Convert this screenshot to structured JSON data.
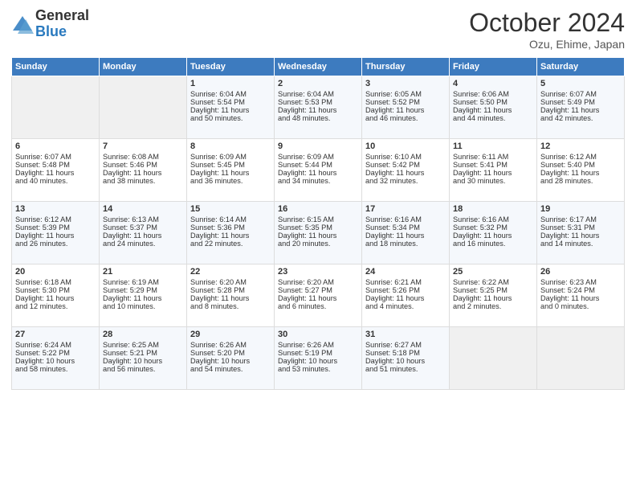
{
  "logo": {
    "general": "General",
    "blue": "Blue"
  },
  "title": "October 2024",
  "subtitle": "Ozu, Ehime, Japan",
  "headers": [
    "Sunday",
    "Monday",
    "Tuesday",
    "Wednesday",
    "Thursday",
    "Friday",
    "Saturday"
  ],
  "weeks": [
    [
      {
        "day": "",
        "lines": []
      },
      {
        "day": "",
        "lines": []
      },
      {
        "day": "1",
        "lines": [
          "Sunrise: 6:04 AM",
          "Sunset: 5:54 PM",
          "Daylight: 11 hours",
          "and 50 minutes."
        ]
      },
      {
        "day": "2",
        "lines": [
          "Sunrise: 6:04 AM",
          "Sunset: 5:53 PM",
          "Daylight: 11 hours",
          "and 48 minutes."
        ]
      },
      {
        "day": "3",
        "lines": [
          "Sunrise: 6:05 AM",
          "Sunset: 5:52 PM",
          "Daylight: 11 hours",
          "and 46 minutes."
        ]
      },
      {
        "day": "4",
        "lines": [
          "Sunrise: 6:06 AM",
          "Sunset: 5:50 PM",
          "Daylight: 11 hours",
          "and 44 minutes."
        ]
      },
      {
        "day": "5",
        "lines": [
          "Sunrise: 6:07 AM",
          "Sunset: 5:49 PM",
          "Daylight: 11 hours",
          "and 42 minutes."
        ]
      }
    ],
    [
      {
        "day": "6",
        "lines": [
          "Sunrise: 6:07 AM",
          "Sunset: 5:48 PM",
          "Daylight: 11 hours",
          "and 40 minutes."
        ]
      },
      {
        "day": "7",
        "lines": [
          "Sunrise: 6:08 AM",
          "Sunset: 5:46 PM",
          "Daylight: 11 hours",
          "and 38 minutes."
        ]
      },
      {
        "day": "8",
        "lines": [
          "Sunrise: 6:09 AM",
          "Sunset: 5:45 PM",
          "Daylight: 11 hours",
          "and 36 minutes."
        ]
      },
      {
        "day": "9",
        "lines": [
          "Sunrise: 6:09 AM",
          "Sunset: 5:44 PM",
          "Daylight: 11 hours",
          "and 34 minutes."
        ]
      },
      {
        "day": "10",
        "lines": [
          "Sunrise: 6:10 AM",
          "Sunset: 5:42 PM",
          "Daylight: 11 hours",
          "and 32 minutes."
        ]
      },
      {
        "day": "11",
        "lines": [
          "Sunrise: 6:11 AM",
          "Sunset: 5:41 PM",
          "Daylight: 11 hours",
          "and 30 minutes."
        ]
      },
      {
        "day": "12",
        "lines": [
          "Sunrise: 6:12 AM",
          "Sunset: 5:40 PM",
          "Daylight: 11 hours",
          "and 28 minutes."
        ]
      }
    ],
    [
      {
        "day": "13",
        "lines": [
          "Sunrise: 6:12 AM",
          "Sunset: 5:39 PM",
          "Daylight: 11 hours",
          "and 26 minutes."
        ]
      },
      {
        "day": "14",
        "lines": [
          "Sunrise: 6:13 AM",
          "Sunset: 5:37 PM",
          "Daylight: 11 hours",
          "and 24 minutes."
        ]
      },
      {
        "day": "15",
        "lines": [
          "Sunrise: 6:14 AM",
          "Sunset: 5:36 PM",
          "Daylight: 11 hours",
          "and 22 minutes."
        ]
      },
      {
        "day": "16",
        "lines": [
          "Sunrise: 6:15 AM",
          "Sunset: 5:35 PM",
          "Daylight: 11 hours",
          "and 20 minutes."
        ]
      },
      {
        "day": "17",
        "lines": [
          "Sunrise: 6:16 AM",
          "Sunset: 5:34 PM",
          "Daylight: 11 hours",
          "and 18 minutes."
        ]
      },
      {
        "day": "18",
        "lines": [
          "Sunrise: 6:16 AM",
          "Sunset: 5:32 PM",
          "Daylight: 11 hours",
          "and 16 minutes."
        ]
      },
      {
        "day": "19",
        "lines": [
          "Sunrise: 6:17 AM",
          "Sunset: 5:31 PM",
          "Daylight: 11 hours",
          "and 14 minutes."
        ]
      }
    ],
    [
      {
        "day": "20",
        "lines": [
          "Sunrise: 6:18 AM",
          "Sunset: 5:30 PM",
          "Daylight: 11 hours",
          "and 12 minutes."
        ]
      },
      {
        "day": "21",
        "lines": [
          "Sunrise: 6:19 AM",
          "Sunset: 5:29 PM",
          "Daylight: 11 hours",
          "and 10 minutes."
        ]
      },
      {
        "day": "22",
        "lines": [
          "Sunrise: 6:20 AM",
          "Sunset: 5:28 PM",
          "Daylight: 11 hours",
          "and 8 minutes."
        ]
      },
      {
        "day": "23",
        "lines": [
          "Sunrise: 6:20 AM",
          "Sunset: 5:27 PM",
          "Daylight: 11 hours",
          "and 6 minutes."
        ]
      },
      {
        "day": "24",
        "lines": [
          "Sunrise: 6:21 AM",
          "Sunset: 5:26 PM",
          "Daylight: 11 hours",
          "and 4 minutes."
        ]
      },
      {
        "day": "25",
        "lines": [
          "Sunrise: 6:22 AM",
          "Sunset: 5:25 PM",
          "Daylight: 11 hours",
          "and 2 minutes."
        ]
      },
      {
        "day": "26",
        "lines": [
          "Sunrise: 6:23 AM",
          "Sunset: 5:24 PM",
          "Daylight: 11 hours",
          "and 0 minutes."
        ]
      }
    ],
    [
      {
        "day": "27",
        "lines": [
          "Sunrise: 6:24 AM",
          "Sunset: 5:22 PM",
          "Daylight: 10 hours",
          "and 58 minutes."
        ]
      },
      {
        "day": "28",
        "lines": [
          "Sunrise: 6:25 AM",
          "Sunset: 5:21 PM",
          "Daylight: 10 hours",
          "and 56 minutes."
        ]
      },
      {
        "day": "29",
        "lines": [
          "Sunrise: 6:26 AM",
          "Sunset: 5:20 PM",
          "Daylight: 10 hours",
          "and 54 minutes."
        ]
      },
      {
        "day": "30",
        "lines": [
          "Sunrise: 6:26 AM",
          "Sunset: 5:19 PM",
          "Daylight: 10 hours",
          "and 53 minutes."
        ]
      },
      {
        "day": "31",
        "lines": [
          "Sunrise: 6:27 AM",
          "Sunset: 5:18 PM",
          "Daylight: 10 hours",
          "and 51 minutes."
        ]
      },
      {
        "day": "",
        "lines": []
      },
      {
        "day": "",
        "lines": []
      }
    ]
  ]
}
